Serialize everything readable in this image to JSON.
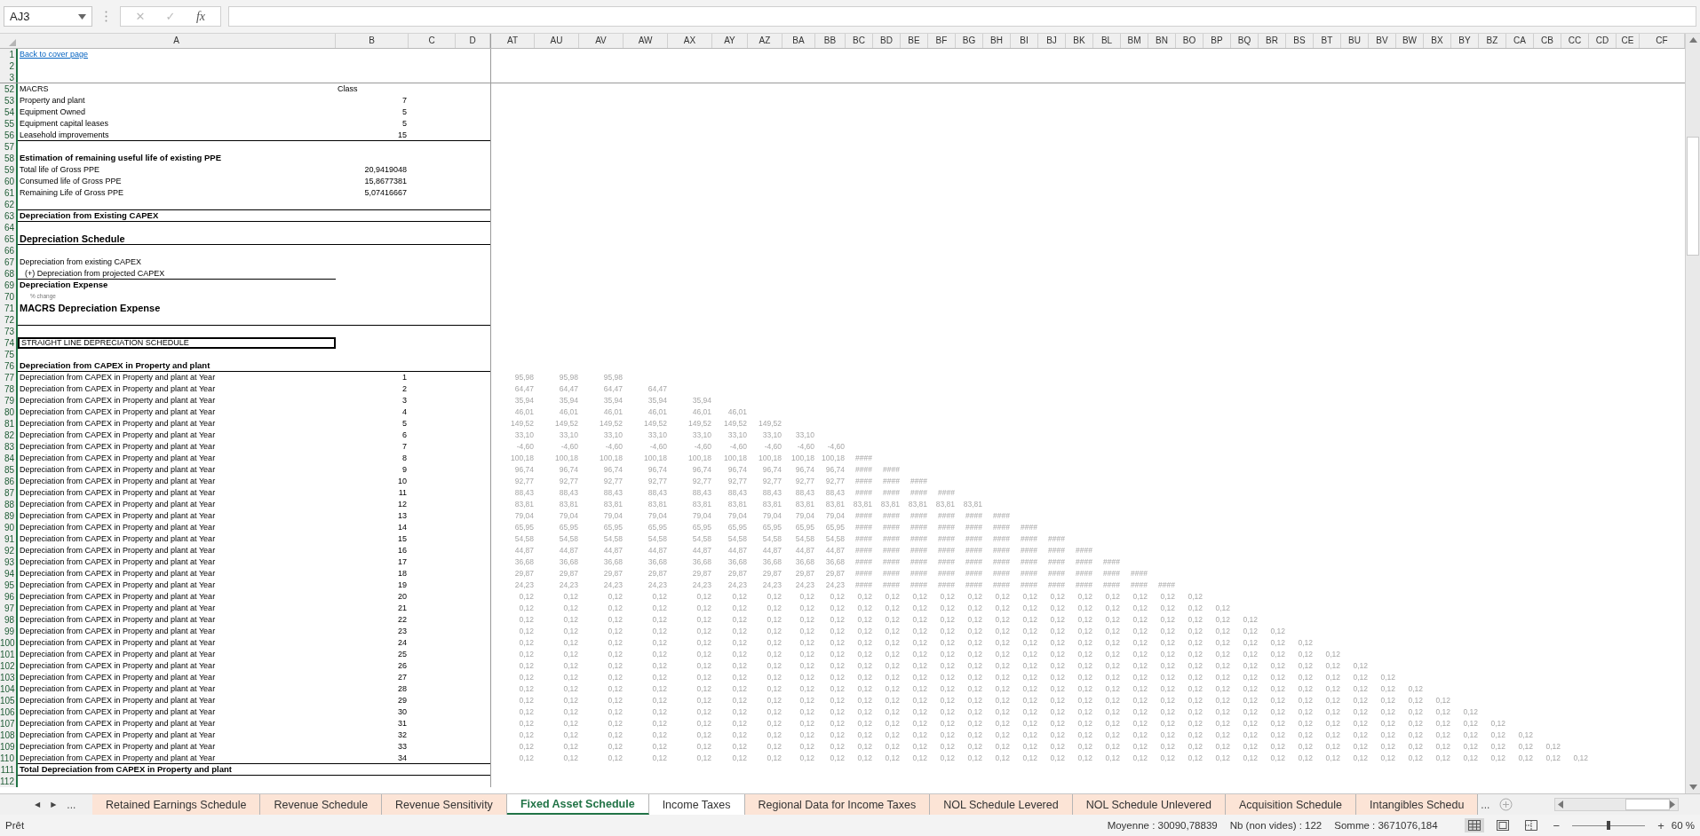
{
  "formula_bar": {
    "name_box": "AJ3",
    "cancel": "✕",
    "enter": "✓",
    "fx": "fx"
  },
  "columns": [
    "A",
    "B",
    "C",
    "D",
    "AT",
    "AU",
    "AV",
    "AW",
    "AX",
    "AY",
    "AZ",
    "BA",
    "BB",
    "BC",
    "BD",
    "BE",
    "BF",
    "BG",
    "BH",
    "BI",
    "BJ",
    "BK",
    "BL",
    "BM",
    "BN",
    "BO",
    "BP",
    "BQ",
    "BR",
    "BS",
    "BT",
    "BU",
    "BV",
    "BW",
    "BX",
    "BY",
    "BZ",
    "CA",
    "CB",
    "CC",
    "CD",
    "CE",
    "CF"
  ],
  "rows": [
    {
      "num": "1",
      "a": "Back to cover page",
      "kind": "link",
      "ruled": false
    },
    {
      "num": "2",
      "ruled": false
    },
    {
      "num": "3",
      "ruled": false
    },
    {
      "num": "52",
      "a": "MACRS",
      "b": "Class",
      "kind": "heading",
      "ruled": false
    },
    {
      "num": "53",
      "a": "Property and plant",
      "b": "7",
      "kind": "plain",
      "ruled": false
    },
    {
      "num": "54",
      "a": "Equipment Owned",
      "b": "5",
      "kind": "plain",
      "ruled": false
    },
    {
      "num": "55",
      "a": "Equipment capital leases",
      "b": "5",
      "kind": "plain",
      "ruled": false
    },
    {
      "num": "56",
      "a": "Leasehold improvements",
      "b": "15",
      "kind": "plain",
      "ruled": true
    },
    {
      "num": "57",
      "ruled": false
    },
    {
      "num": "58",
      "a": "Estimation of remaining useful life of existing PPE",
      "kind": "bold",
      "ruled": false
    },
    {
      "num": "59",
      "a": "Total life of Gross PPE",
      "b": "20,9419048",
      "kind": "plain",
      "ruled": false
    },
    {
      "num": "60",
      "a": "Consumed life of Gross PPE",
      "b": "15,8677381",
      "kind": "plain",
      "ruled": false
    },
    {
      "num": "61",
      "a": "Remaining Life of Gross PPE",
      "b": "5,07416667",
      "kind": "plain",
      "ruled": false
    },
    {
      "num": "62",
      "ruled": true
    },
    {
      "num": "63",
      "a": "Depreciation from Existing CAPEX",
      "kind": "bold",
      "ruled": true
    },
    {
      "num": "64",
      "ruled": false
    },
    {
      "num": "65",
      "a": "Depreciation Schedule",
      "kind": "title",
      "ruled": true
    },
    {
      "num": "66",
      "ruled": false
    },
    {
      "num": "67",
      "a": "Depreciation from existing CAPEX",
      "kind": "plain",
      "ruled": false
    },
    {
      "num": "68",
      "a": "(+) Depreciation from projected CAPEX",
      "kind": "indent",
      "ruled": false
    },
    {
      "num": "69",
      "a": "Depreciation Expense",
      "kind": "bold",
      "ruled": false
    },
    {
      "num": "70",
      "a": "% change",
      "kind": "note",
      "ruled": false
    },
    {
      "num": "71",
      "a": "MACRS Depreciation Expense",
      "kind": "title",
      "ruled": false
    },
    {
      "num": "72",
      "ruled": true
    },
    {
      "num": "73",
      "ruled": false
    },
    {
      "num": "74",
      "a": "STRAIGHT LINE DEPRECIATION SCHEDULE",
      "kind": "boxed",
      "ruled": false
    },
    {
      "num": "75",
      "ruled": false
    },
    {
      "num": "76",
      "a": "Depreciation from CAPEX in Property and plant",
      "kind": "bold",
      "ruled": true
    },
    {
      "num": "77",
      "a": "Depreciation from CAPEX in Property and plant at Year",
      "b": "1",
      "kind": "plain",
      "ruled": false,
      "values": [
        "95,98",
        "95,98",
        "95,98"
      ]
    },
    {
      "num": "78",
      "a": "Depreciation from CAPEX in Property and plant at Year",
      "b": "2",
      "kind": "plain",
      "ruled": false,
      "values": [
        "64,47",
        "64,47",
        "64,47",
        "64,47"
      ]
    },
    {
      "num": "79",
      "a": "Depreciation from CAPEX in Property and plant at Year",
      "b": "3",
      "kind": "plain",
      "ruled": false,
      "values": [
        "35,94",
        "35,94",
        "35,94",
        "35,94",
        "35,94"
      ]
    },
    {
      "num": "80",
      "a": "Depreciation from CAPEX in Property and plant at Year",
      "b": "4",
      "kind": "plain",
      "ruled": false,
      "values": [
        "46,01",
        "46,01",
        "46,01",
        "46,01",
        "46,01",
        "46,01"
      ]
    },
    {
      "num": "81",
      "a": "Depreciation from CAPEX in Property and plant at Year",
      "b": "5",
      "kind": "plain",
      "ruled": false,
      "values": [
        "149,52",
        "149,52",
        "149,52",
        "149,52",
        "149,52",
        "149,52",
        "149,52"
      ]
    },
    {
      "num": "82",
      "a": "Depreciation from CAPEX in Property and plant at Year",
      "b": "6",
      "kind": "plain",
      "ruled": false,
      "values": [
        "33,10",
        "33,10",
        "33,10",
        "33,10",
        "33,10",
        "33,10",
        "33,10",
        "33,10"
      ]
    },
    {
      "num": "83",
      "a": "Depreciation from CAPEX in Property and plant at Year",
      "b": "7",
      "kind": "plain",
      "ruled": false,
      "values": [
        "-4,60",
        "-4,60",
        "-4,60",
        "-4,60",
        "-4,60",
        "-4,60",
        "-4,60",
        "-4,60",
        "-4,60"
      ]
    },
    {
      "num": "84",
      "a": "Depreciation from CAPEX in Property and plant at Year",
      "b": "8",
      "kind": "plain",
      "ruled": false,
      "values": [
        "100,18",
        "100,18",
        "100,18",
        "100,18",
        "100,18",
        "100,18",
        "100,18",
        "100,18",
        "100,18",
        "####"
      ]
    },
    {
      "num": "85",
      "a": "Depreciation from CAPEX in Property and plant at Year",
      "b": "9",
      "kind": "plain",
      "ruled": false,
      "values": [
        "96,74",
        "96,74",
        "96,74",
        "96,74",
        "96,74",
        "96,74",
        "96,74",
        "96,74",
        "96,74",
        "####",
        "####"
      ]
    },
    {
      "num": "86",
      "a": "Depreciation from CAPEX in Property and plant at Year",
      "b": "10",
      "kind": "plain",
      "ruled": false,
      "values": [
        "92,77",
        "92,77",
        "92,77",
        "92,77",
        "92,77",
        "92,77",
        "92,77",
        "92,77",
        "92,77",
        "####",
        "####",
        "####"
      ]
    },
    {
      "num": "87",
      "a": "Depreciation from CAPEX in Property and plant at Year",
      "b": "11",
      "kind": "plain",
      "ruled": false,
      "values": [
        "88,43",
        "88,43",
        "88,43",
        "88,43",
        "88,43",
        "88,43",
        "88,43",
        "88,43",
        "88,43",
        "####",
        "####",
        "####",
        "####"
      ]
    },
    {
      "num": "88",
      "a": "Depreciation from CAPEX in Property and plant at Year",
      "b": "12",
      "kind": "plain",
      "ruled": false,
      "values": [
        "83,81",
        "83,81",
        "83,81",
        "83,81",
        "83,81",
        "83,81",
        "83,81",
        "83,81",
        "83,81",
        "83,81",
        "83,81",
        "83,81",
        "83,81",
        "83,81"
      ]
    },
    {
      "num": "89",
      "a": "Depreciation from CAPEX in Property and plant at Year",
      "b": "13",
      "kind": "plain",
      "ruled": false,
      "values": [
        "79,04",
        "79,04",
        "79,04",
        "79,04",
        "79,04",
        "79,04",
        "79,04",
        "79,04",
        "79,04",
        "####",
        "####",
        "####",
        "####",
        "####",
        "####"
      ]
    },
    {
      "num": "90",
      "a": "Depreciation from CAPEX in Property and plant at Year",
      "b": "14",
      "kind": "plain",
      "ruled": false,
      "values": [
        "65,95",
        "65,95",
        "65,95",
        "65,95",
        "65,95",
        "65,95",
        "65,95",
        "65,95",
        "65,95",
        "####",
        "####",
        "####",
        "####",
        "####",
        "####",
        "####"
      ]
    },
    {
      "num": "91",
      "a": "Depreciation from CAPEX in Property and plant at Year",
      "b": "15",
      "kind": "plain",
      "ruled": false,
      "values": [
        "54,58",
        "54,58",
        "54,58",
        "54,58",
        "54,58",
        "54,58",
        "54,58",
        "54,58",
        "54,58",
        "####",
        "####",
        "####",
        "####",
        "####",
        "####",
        "####",
        "####"
      ]
    },
    {
      "num": "92",
      "a": "Depreciation from CAPEX in Property and plant at Year",
      "b": "16",
      "kind": "plain",
      "ruled": false,
      "values": [
        "44,87",
        "44,87",
        "44,87",
        "44,87",
        "44,87",
        "44,87",
        "44,87",
        "44,87",
        "44,87",
        "####",
        "####",
        "####",
        "####",
        "####",
        "####",
        "####",
        "####",
        "####"
      ]
    },
    {
      "num": "93",
      "a": "Depreciation from CAPEX in Property and plant at Year",
      "b": "17",
      "kind": "plain",
      "ruled": false,
      "values": [
        "36,68",
        "36,68",
        "36,68",
        "36,68",
        "36,68",
        "36,68",
        "36,68",
        "36,68",
        "36,68",
        "####",
        "####",
        "####",
        "####",
        "####",
        "####",
        "####",
        "####",
        "####",
        "####"
      ]
    },
    {
      "num": "94",
      "a": "Depreciation from CAPEX in Property and plant at Year",
      "b": "18",
      "kind": "plain",
      "ruled": false,
      "values": [
        "29,87",
        "29,87",
        "29,87",
        "29,87",
        "29,87",
        "29,87",
        "29,87",
        "29,87",
        "29,87",
        "####",
        "####",
        "####",
        "####",
        "####",
        "####",
        "####",
        "####",
        "####",
        "####",
        "####"
      ]
    },
    {
      "num": "95",
      "a": "Depreciation from CAPEX in Property and plant at Year",
      "b": "19",
      "kind": "plain",
      "ruled": false,
      "values": [
        "24,23",
        "24,23",
        "24,23",
        "24,23",
        "24,23",
        "24,23",
        "24,23",
        "24,23",
        "24,23",
        "####",
        "####",
        "####",
        "####",
        "####",
        "####",
        "####",
        "####",
        "####",
        "####",
        "####",
        "####"
      ]
    },
    {
      "num": "96",
      "a": "Depreciation from CAPEX in Property and plant at Year",
      "b": "20",
      "kind": "plain",
      "ruled": false,
      "values": [
        "0,12",
        "0,12",
        "0,12",
        "0,12",
        "0,12",
        "0,12",
        "0,12",
        "0,12",
        "0,12",
        "0,12",
        "0,12",
        "0,12",
        "0,12",
        "0,12",
        "0,12",
        "0,12",
        "0,12",
        "0,12",
        "0,12",
        "0,12",
        "0,12",
        "0,12"
      ]
    },
    {
      "num": "97",
      "a": "Depreciation from CAPEX in Property and plant at Year",
      "b": "21",
      "kind": "plain",
      "ruled": false,
      "values": [
        "0,12",
        "0,12",
        "0,12",
        "0,12",
        "0,12",
        "0,12",
        "0,12",
        "0,12",
        "0,12",
        "0,12",
        "0,12",
        "0,12",
        "0,12",
        "0,12",
        "0,12",
        "0,12",
        "0,12",
        "0,12",
        "0,12",
        "0,12",
        "0,12",
        "0,12",
        "0,12"
      ]
    },
    {
      "num": "98",
      "a": "Depreciation from CAPEX in Property and plant at Year",
      "b": "22",
      "kind": "plain",
      "ruled": false,
      "values": [
        "0,12",
        "0,12",
        "0,12",
        "0,12",
        "0,12",
        "0,12",
        "0,12",
        "0,12",
        "0,12",
        "0,12",
        "0,12",
        "0,12",
        "0,12",
        "0,12",
        "0,12",
        "0,12",
        "0,12",
        "0,12",
        "0,12",
        "0,12",
        "0,12",
        "0,12",
        "0,12",
        "0,12"
      ]
    },
    {
      "num": "99",
      "a": "Depreciation from CAPEX in Property and plant at Year",
      "b": "23",
      "kind": "plain",
      "ruled": false,
      "values": [
        "0,12",
        "0,12",
        "0,12",
        "0,12",
        "0,12",
        "0,12",
        "0,12",
        "0,12",
        "0,12",
        "0,12",
        "0,12",
        "0,12",
        "0,12",
        "0,12",
        "0,12",
        "0,12",
        "0,12",
        "0,12",
        "0,12",
        "0,12",
        "0,12",
        "0,12",
        "0,12",
        "0,12",
        "0,12"
      ]
    },
    {
      "num": "100",
      "a": "Depreciation from CAPEX in Property and plant at Year",
      "b": "24",
      "kind": "plain",
      "ruled": false,
      "values": [
        "0,12",
        "0,12",
        "0,12",
        "0,12",
        "0,12",
        "0,12",
        "0,12",
        "0,12",
        "0,12",
        "0,12",
        "0,12",
        "0,12",
        "0,12",
        "0,12",
        "0,12",
        "0,12",
        "0,12",
        "0,12",
        "0,12",
        "0,12",
        "0,12",
        "0,12",
        "0,12",
        "0,12",
        "0,12",
        "0,12"
      ]
    },
    {
      "num": "101",
      "a": "Depreciation from CAPEX in Property and plant at Year",
      "b": "25",
      "kind": "plain",
      "ruled": false,
      "values": [
        "0,12",
        "0,12",
        "0,12",
        "0,12",
        "0,12",
        "0,12",
        "0,12",
        "0,12",
        "0,12",
        "0,12",
        "0,12",
        "0,12",
        "0,12",
        "0,12",
        "0,12",
        "0,12",
        "0,12",
        "0,12",
        "0,12",
        "0,12",
        "0,12",
        "0,12",
        "0,12",
        "0,12",
        "0,12",
        "0,12",
        "0,12"
      ]
    },
    {
      "num": "102",
      "a": "Depreciation from CAPEX in Property and plant at Year",
      "b": "26",
      "kind": "plain",
      "ruled": false,
      "values": [
        "0,12",
        "0,12",
        "0,12",
        "0,12",
        "0,12",
        "0,12",
        "0,12",
        "0,12",
        "0,12",
        "0,12",
        "0,12",
        "0,12",
        "0,12",
        "0,12",
        "0,12",
        "0,12",
        "0,12",
        "0,12",
        "0,12",
        "0,12",
        "0,12",
        "0,12",
        "0,12",
        "0,12",
        "0,12",
        "0,12",
        "0,12",
        "0,12"
      ]
    },
    {
      "num": "103",
      "a": "Depreciation from CAPEX in Property and plant at Year",
      "b": "27",
      "kind": "plain",
      "ruled": false,
      "values": [
        "0,12",
        "0,12",
        "0,12",
        "0,12",
        "0,12",
        "0,12",
        "0,12",
        "0,12",
        "0,12",
        "0,12",
        "0,12",
        "0,12",
        "0,12",
        "0,12",
        "0,12",
        "0,12",
        "0,12",
        "0,12",
        "0,12",
        "0,12",
        "0,12",
        "0,12",
        "0,12",
        "0,12",
        "0,12",
        "0,12",
        "0,12",
        "0,12",
        "0,12"
      ]
    },
    {
      "num": "104",
      "a": "Depreciation from CAPEX in Property and plant at Year",
      "b": "28",
      "kind": "plain",
      "ruled": false,
      "values": [
        "0,12",
        "0,12",
        "0,12",
        "0,12",
        "0,12",
        "0,12",
        "0,12",
        "0,12",
        "0,12",
        "0,12",
        "0,12",
        "0,12",
        "0,12",
        "0,12",
        "0,12",
        "0,12",
        "0,12",
        "0,12",
        "0,12",
        "0,12",
        "0,12",
        "0,12",
        "0,12",
        "0,12",
        "0,12",
        "0,12",
        "0,12",
        "0,12",
        "0,12",
        "0,12"
      ]
    },
    {
      "num": "105",
      "a": "Depreciation from CAPEX in Property and plant at Year",
      "b": "29",
      "kind": "plain",
      "ruled": false,
      "values": [
        "0,12",
        "0,12",
        "0,12",
        "0,12",
        "0,12",
        "0,12",
        "0,12",
        "0,12",
        "0,12",
        "0,12",
        "0,12",
        "0,12",
        "0,12",
        "0,12",
        "0,12",
        "0,12",
        "0,12",
        "0,12",
        "0,12",
        "0,12",
        "0,12",
        "0,12",
        "0,12",
        "0,12",
        "0,12",
        "0,12",
        "0,12",
        "0,12",
        "0,12",
        "0,12",
        "0,12"
      ]
    },
    {
      "num": "106",
      "a": "Depreciation from CAPEX in Property and plant at Year",
      "b": "30",
      "kind": "plain",
      "ruled": false,
      "values": [
        "0,12",
        "0,12",
        "0,12",
        "0,12",
        "0,12",
        "0,12",
        "0,12",
        "0,12",
        "0,12",
        "0,12",
        "0,12",
        "0,12",
        "0,12",
        "0,12",
        "0,12",
        "0,12",
        "0,12",
        "0,12",
        "0,12",
        "0,12",
        "0,12",
        "0,12",
        "0,12",
        "0,12",
        "0,12",
        "0,12",
        "0,12",
        "0,12",
        "0,12",
        "0,12",
        "0,12",
        "0,12"
      ]
    },
    {
      "num": "107",
      "a": "Depreciation from CAPEX in Property and plant at Year",
      "b": "31",
      "kind": "plain",
      "ruled": false,
      "values": [
        "0,12",
        "0,12",
        "0,12",
        "0,12",
        "0,12",
        "0,12",
        "0,12",
        "0,12",
        "0,12",
        "0,12",
        "0,12",
        "0,12",
        "0,12",
        "0,12",
        "0,12",
        "0,12",
        "0,12",
        "0,12",
        "0,12",
        "0,12",
        "0,12",
        "0,12",
        "0,12",
        "0,12",
        "0,12",
        "0,12",
        "0,12",
        "0,12",
        "0,12",
        "0,12",
        "0,12",
        "0,12",
        "0,12"
      ]
    },
    {
      "num": "108",
      "a": "Depreciation from CAPEX in Property and plant at Year",
      "b": "32",
      "kind": "plain",
      "ruled": false,
      "values": [
        "0,12",
        "0,12",
        "0,12",
        "0,12",
        "0,12",
        "0,12",
        "0,12",
        "0,12",
        "0,12",
        "0,12",
        "0,12",
        "0,12",
        "0,12",
        "0,12",
        "0,12",
        "0,12",
        "0,12",
        "0,12",
        "0,12",
        "0,12",
        "0,12",
        "0,12",
        "0,12",
        "0,12",
        "0,12",
        "0,12",
        "0,12",
        "0,12",
        "0,12",
        "0,12",
        "0,12",
        "0,12",
        "0,12",
        "0,12"
      ]
    },
    {
      "num": "109",
      "a": "Depreciation from CAPEX in Property and plant at Year",
      "b": "33",
      "kind": "plain",
      "ruled": false,
      "values": [
        "0,12",
        "0,12",
        "0,12",
        "0,12",
        "0,12",
        "0,12",
        "0,12",
        "0,12",
        "0,12",
        "0,12",
        "0,12",
        "0,12",
        "0,12",
        "0,12",
        "0,12",
        "0,12",
        "0,12",
        "0,12",
        "0,12",
        "0,12",
        "0,12",
        "0,12",
        "0,12",
        "0,12",
        "0,12",
        "0,12",
        "0,12",
        "0,12",
        "0,12",
        "0,12",
        "0,12",
        "0,12",
        "0,12",
        "0,12",
        "0,12"
      ]
    },
    {
      "num": "110",
      "a": "Depreciation from CAPEX in Property and plant at Year",
      "b": "34",
      "kind": "plain",
      "ruled": true,
      "values": [
        "0,12",
        "0,12",
        "0,12",
        "0,12",
        "0,12",
        "0,12",
        "0,12",
        "0,12",
        "0,12",
        "0,12",
        "0,12",
        "0,12",
        "0,12",
        "0,12",
        "0,12",
        "0,12",
        "0,12",
        "0,12",
        "0,12",
        "0,12",
        "0,12",
        "0,12",
        "0,12",
        "0,12",
        "0,12",
        "0,12",
        "0,12",
        "0,12",
        "0,12",
        "0,12",
        "0,12",
        "0,12",
        "0,12",
        "0,12",
        "0,12",
        "0,12"
      ]
    },
    {
      "num": "111",
      "a": "Total Depreciation from CAPEX in Property and plant",
      "kind": "bold",
      "ruled": true
    },
    {
      "num": "112",
      "ruled": false
    }
  ],
  "sheet_tabs": {
    "prev": "◀",
    "next": "▶",
    "more_left": "...",
    "more_right": "...",
    "tabs": [
      {
        "label": "Retained Earnings Schedule",
        "selected": false,
        "color": "#fce4d6"
      },
      {
        "label": "Revenue Schedule",
        "selected": false,
        "color": "#fce4d6"
      },
      {
        "label": "Revenue Sensitivity",
        "selected": false,
        "color": "#fce4d6"
      },
      {
        "label": "Fixed Asset Schedule",
        "selected": true,
        "color": "#ffffff"
      },
      {
        "label": "Income Taxes",
        "selected": false,
        "color": "#ffffff"
      },
      {
        "label": "Regional Data for Income Taxes",
        "selected": false,
        "color": "#fce4d6"
      },
      {
        "label": "NOL Schedule Levered",
        "selected": false,
        "color": "#fce4d6"
      },
      {
        "label": "NOL Schedule Unlevered",
        "selected": false,
        "color": "#fce4d6"
      },
      {
        "label": "Acquisition Schedule",
        "selected": false,
        "color": "#fce4d6"
      },
      {
        "label": "Intangibles Schedu",
        "selected": false,
        "color": "#fce4d6"
      }
    ]
  },
  "status_bar": {
    "mode": "Prêt",
    "average": "Moyenne : 30090,78839",
    "count": "Nb (non vides) : 122",
    "sum": "Somme : 3671076,184",
    "views": [
      {
        "kind": "normal",
        "selected": true
      },
      {
        "kind": "page_layout",
        "selected": false
      },
      {
        "kind": "page_break",
        "selected": false
      }
    ],
    "zoom": {
      "minus": "−",
      "plus": "+",
      "level": 0.5,
      "label": "60 %"
    }
  }
}
